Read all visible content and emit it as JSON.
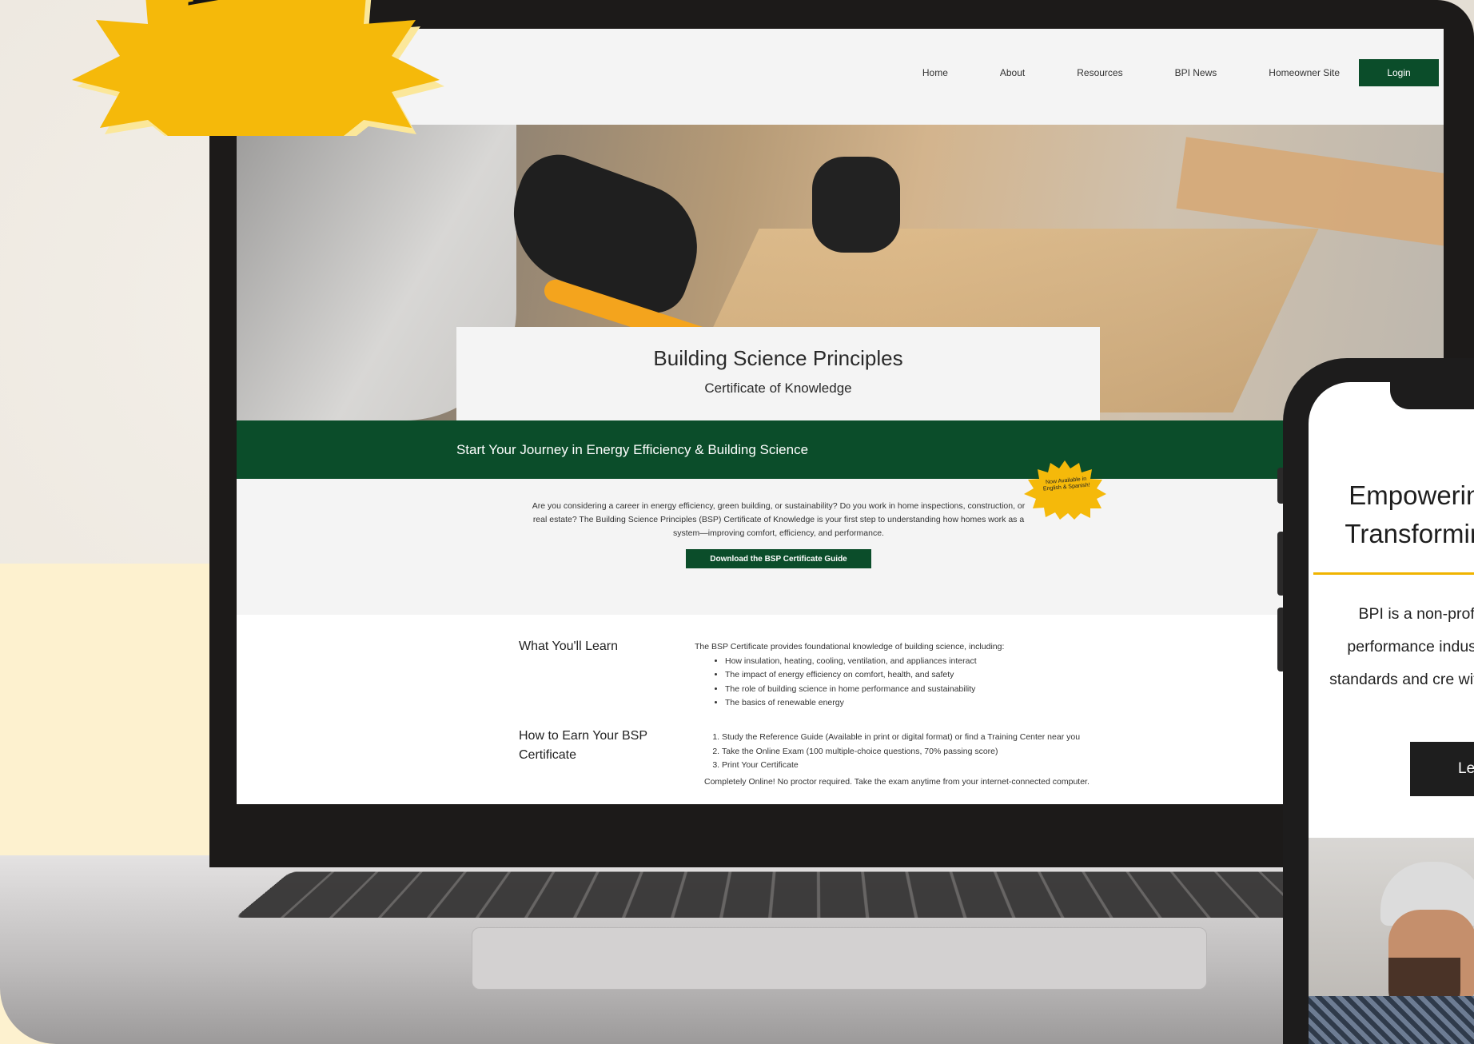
{
  "badge": {
    "text": "Launched!"
  },
  "site": {
    "nav": [
      "Home",
      "About",
      "Resources",
      "BPI News",
      "Homeowner Site"
    ],
    "login_label": "Login",
    "hero_title": "Building Science Principles",
    "hero_subtitle": "Certificate of Knowledge",
    "banner_text": "Start Your Journey in Energy Efficiency & Building Science",
    "mini_badge": "Now Available in English & Spanish!",
    "intro_text": "Are you considering a career in energy efficiency, green building, or sustainability? Do you work in home inspections, construction, or real estate? The Building Science Principles (BSP) Certificate of Knowledge is your first step to understanding how homes work as a system—improving comfort, efficiency, and performance.",
    "download_label": "Download the BSP Certificate Guide",
    "learn": {
      "title": "What You'll Learn",
      "lead": "The BSP Certificate provides foundational knowledge of building science, including:",
      "items": [
        "How insulation, heating, cooling, ventilation, and appliances interact",
        "The impact of energy efficiency on comfort, health, and safety",
        "The role of building science in home performance and sustainability",
        "The basics of renewable energy"
      ]
    },
    "earn": {
      "title": "How to Earn Your BSP Certificate",
      "steps": [
        "Study the Reference Guide (Available in print or digital format) or find a Training Center near you",
        "Take the Online Exam (100 multiple-choice questions, 70% passing score)",
        "Print Your Certificate"
      ],
      "note": "Completely Online! No proctor required. Take the exam anytime from your internet-connected computer."
    }
  },
  "phone": {
    "title": "Empowering Transforming",
    "body": "BPI is a non-profit performance industry standards and cre with lea",
    "button_label": "Le"
  },
  "colors": {
    "brand_green": "#0b4d2a",
    "accent_yellow": "#f5b90a"
  }
}
